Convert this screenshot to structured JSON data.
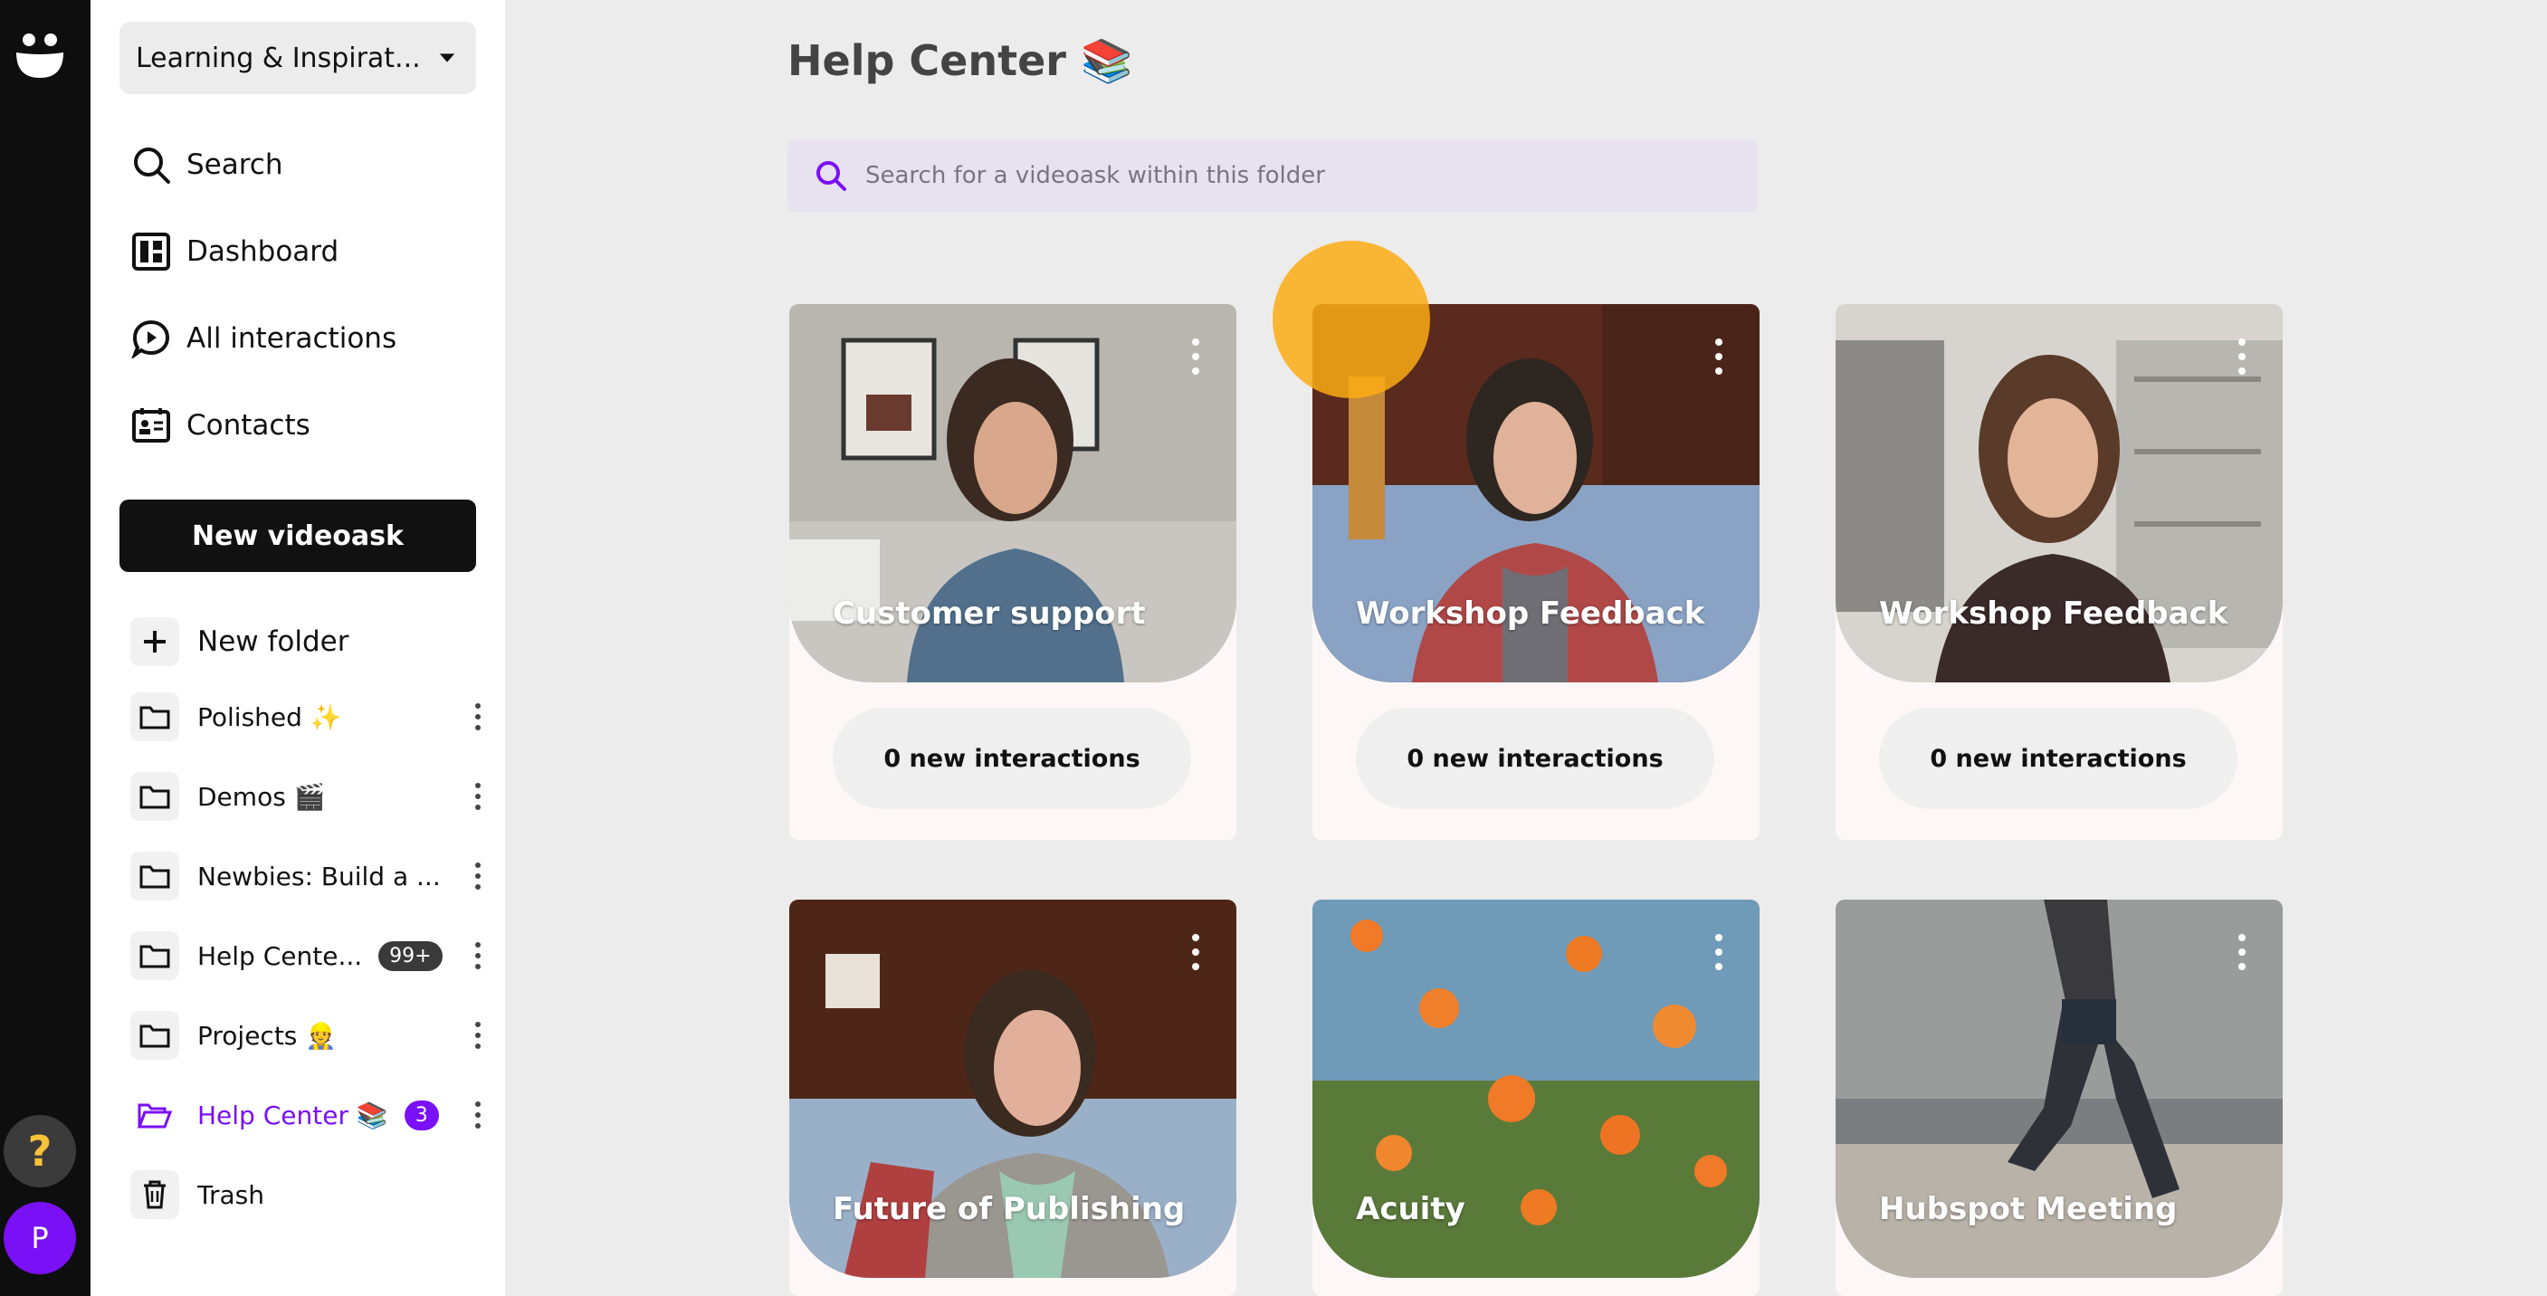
{
  "workspace": {
    "label": "Learning & Inspirat..."
  },
  "nav": [
    {
      "label": "Search",
      "icon": "search-icon"
    },
    {
      "label": "Dashboard",
      "icon": "dashboard-icon"
    },
    {
      "label": "All interactions",
      "icon": "interactions-icon"
    },
    {
      "label": "Contacts",
      "icon": "contacts-icon"
    }
  ],
  "new_videoask_label": "New videoask",
  "new_folder_label": "New folder",
  "folders": [
    {
      "name": "Polished ✨",
      "badge": ""
    },
    {
      "name": "Demos 🎬",
      "badge": ""
    },
    {
      "name": "Newbies: Build a ...",
      "badge": ""
    },
    {
      "name": "Help Cente...",
      "badge": "99+"
    },
    {
      "name": "Projects 👷",
      "badge": ""
    },
    {
      "name": "Help Center 📚",
      "badge": "3"
    },
    {
      "name": "Trash",
      "badge": ""
    }
  ],
  "page_title": "Help Center 📚",
  "search_placeholder": "Search for a videoask within this folder",
  "cards": [
    {
      "title": "Customer support",
      "interactions": "0 new interactions"
    },
    {
      "title": "Workshop Feedback",
      "interactions": "0 new interactions"
    },
    {
      "title": "Workshop Feedback",
      "interactions": "0 new interactions"
    },
    {
      "title": "Future of Publishing",
      "interactions": ""
    },
    {
      "title": "Acuity",
      "interactions": ""
    },
    {
      "title": "Hubspot Meeting",
      "interactions": ""
    }
  ],
  "rail": {
    "help_icon": "?",
    "avatar_initial": "P"
  },
  "colors": {
    "accent": "#7a10f5",
    "cursor_highlight": "#fcac14"
  }
}
